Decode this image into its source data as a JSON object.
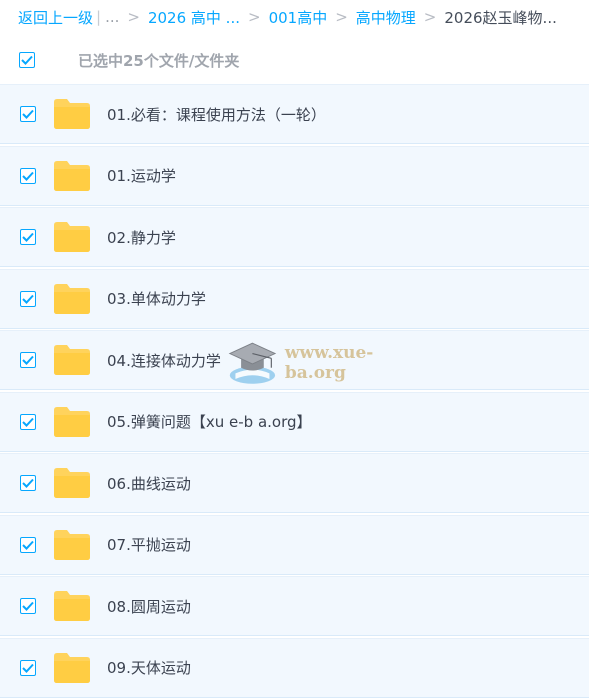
{
  "breadcrumb": {
    "back": "返回上一级",
    "ellipsis": "...",
    "items": [
      "2026 高中 ...",
      "001高中",
      "高中物理"
    ],
    "current": "2026赵玉峰物..."
  },
  "selection": {
    "count_label": "已选中25个文件/文件夹",
    "checked": true
  },
  "files": [
    {
      "name": "01.必看：课程使用方法（一轮）",
      "checked": true
    },
    {
      "name": "01.运动学",
      "checked": true
    },
    {
      "name": "02.静力学",
      "checked": true
    },
    {
      "name": "03.单体动力学",
      "checked": true
    },
    {
      "name": "04.连接体动力学",
      "checked": true
    },
    {
      "name": "05.弹簧问题【xu e-b a.org】",
      "checked": true
    },
    {
      "name": "06.曲线运动",
      "checked": true
    },
    {
      "name": "07.平抛运动",
      "checked": true
    },
    {
      "name": "08.圆周运动",
      "checked": true
    },
    {
      "name": "09.天体运动",
      "checked": true
    }
  ],
  "watermark": {
    "text": "www.xue-ba.org"
  },
  "colors": {
    "accent": "#06a7ff",
    "row_bg": "#f2f8fe",
    "folder": "#ffd35c",
    "text": "#3b4250"
  },
  "icons": {
    "checkbox": "check-icon",
    "folder": "folder-icon",
    "watermark": "graduation-cap-icon"
  }
}
